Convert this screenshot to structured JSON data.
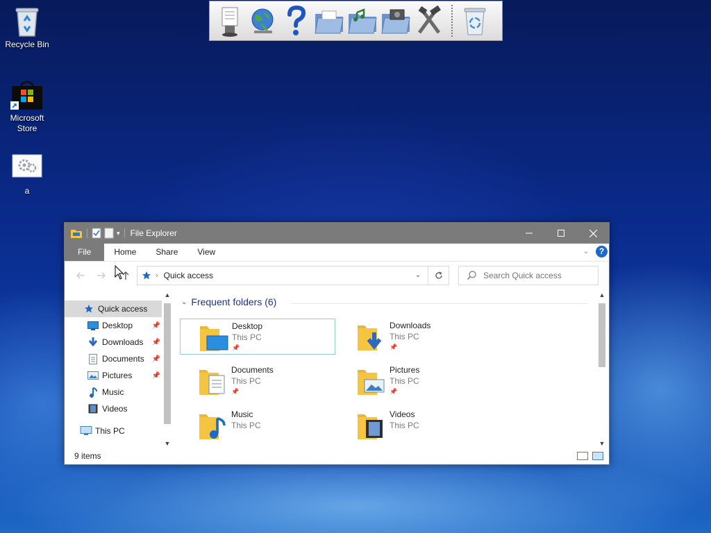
{
  "desktop": {
    "icons": [
      {
        "label": "Recycle Bin",
        "icon": "recycle-bin-icon"
      },
      {
        "label": "Microsoft\nStore",
        "icon": "microsoft-store-icon"
      },
      {
        "label": "a",
        "icon": "settings-file-icon"
      }
    ]
  },
  "toolbar": {
    "buttons": [
      "document-viewer-icon",
      "globe-icon",
      "help-icon",
      "folder-icon",
      "music-folder-icon",
      "photo-folder-icon",
      "tools-icon",
      "recycle-bin-icon"
    ]
  },
  "window": {
    "title": "File Explorer",
    "ribbon_tabs": [
      "File",
      "Home",
      "Share",
      "View"
    ],
    "address": {
      "location": "Quick access"
    },
    "search": {
      "placeholder": "Search Quick access"
    },
    "nav": [
      {
        "label": "Quick access",
        "icon": "star-icon",
        "active": true
      },
      {
        "label": "Desktop",
        "icon": "desktop-icon",
        "pinned": true
      },
      {
        "label": "Downloads",
        "icon": "download-arrow-icon",
        "pinned": true
      },
      {
        "label": "Documents",
        "icon": "document-icon",
        "pinned": true
      },
      {
        "label": "Pictures",
        "icon": "pictures-icon",
        "pinned": true
      },
      {
        "label": "Music",
        "icon": "music-note-icon"
      },
      {
        "label": "Videos",
        "icon": "film-icon"
      },
      {
        "label": "This PC",
        "icon": "computer-icon"
      }
    ],
    "group_header": "Frequent folders (6)",
    "folders": [
      {
        "name": "Desktop",
        "location": "This PC",
        "pinned": true,
        "selected": true
      },
      {
        "name": "Downloads",
        "location": "This PC",
        "pinned": true
      },
      {
        "name": "Documents",
        "location": "This PC",
        "pinned": true
      },
      {
        "name": "Pictures",
        "location": "This PC",
        "pinned": true
      },
      {
        "name": "Music",
        "location": "This PC",
        "pinned": false
      },
      {
        "name": "Videos",
        "location": "This PC",
        "pinned": false
      }
    ],
    "status": "9 items",
    "colors": {
      "titlebar": "#7b7b7b",
      "accent": "#1b6ac9",
      "folder": "#f5c542",
      "selection_border": "#8fd0cf"
    }
  }
}
